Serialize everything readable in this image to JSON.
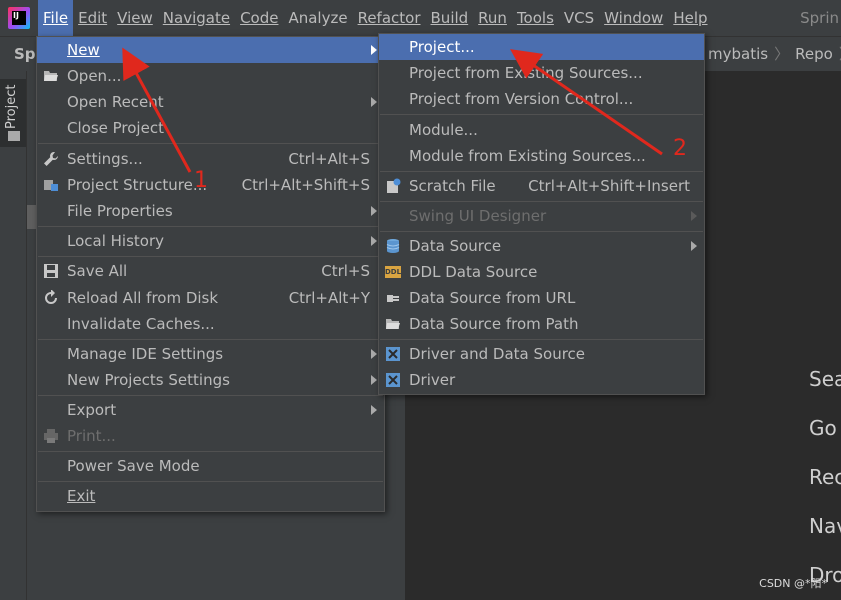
{
  "menubar": {
    "items": [
      "File",
      "Edit",
      "View",
      "Navigate",
      "Code",
      "Analyze",
      "Refactor",
      "Build",
      "Run",
      "Tools",
      "VCS",
      "Window",
      "Help"
    ],
    "underline_first": [
      true,
      true,
      true,
      true,
      true,
      false,
      true,
      true,
      true,
      true,
      false,
      true,
      true
    ],
    "cut_right": "Sprin"
  },
  "navbar": {
    "project_short": "Spr",
    "crumbs": [
      "mybatis",
      "Repo"
    ]
  },
  "toolwindow": {
    "project_label": "Project"
  },
  "file_menu": {
    "new": "New",
    "open": "Open...",
    "open_recent": "Open Recent",
    "close_project": "Close Project",
    "settings": "Settings...",
    "settings_sc": "Ctrl+Alt+S",
    "project_structure": "Project Structure...",
    "project_structure_sc": "Ctrl+Alt+Shift+S",
    "file_properties": "File Properties",
    "local_history": "Local History",
    "save_all": "Save All",
    "save_all_sc": "Ctrl+S",
    "reload": "Reload All from Disk",
    "reload_sc": "Ctrl+Alt+Y",
    "invalidate": "Invalidate Caches...",
    "manage_ide": "Manage IDE Settings",
    "new_projects_settings": "New Projects Settings",
    "export": "Export",
    "print": "Print...",
    "power_save": "Power Save Mode",
    "exit": "Exit"
  },
  "new_menu": {
    "project": "Project...",
    "from_existing": "Project from Existing Sources...",
    "from_vcs": "Project from Version Control...",
    "module": "Module...",
    "module_existing": "Module from Existing Sources...",
    "scratch": "Scratch File",
    "scratch_sc": "Ctrl+Alt+Shift+Insert",
    "swing": "Swing UI Designer",
    "data_source": "Data Source",
    "ddl": "DDL Data Source",
    "ds_url": "Data Source from URL",
    "ds_path": "Data Source from Path",
    "driver_ds": "Driver and Data Source",
    "driver": "Driver",
    "ddl_badge": "DDL"
  },
  "welcome": [
    "Sea",
    "Go",
    "Rec",
    "Nav",
    "Dro"
  ],
  "annotations": {
    "one": "1",
    "two": "2"
  },
  "watermark": "CSDN @*阳*",
  "colors": {
    "selection": "#4b6eaf",
    "annotation": "#e0281d",
    "background": "#2b2b2b",
    "panel": "#3c3f41"
  }
}
